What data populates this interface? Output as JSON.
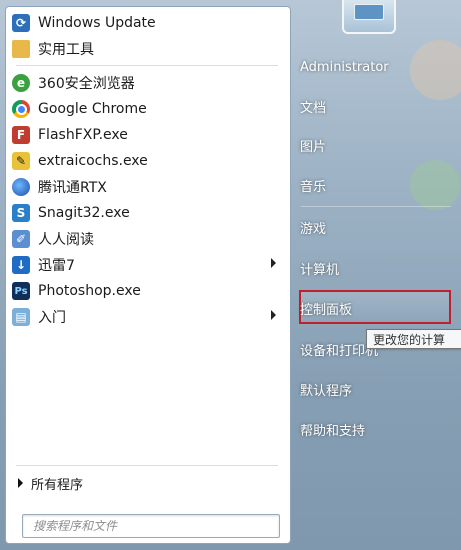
{
  "programs": [
    {
      "label": "Windows Update",
      "icon": "windows-update-icon",
      "arrow": false
    },
    {
      "label": "实用工具",
      "icon": "folder-icon",
      "arrow": false
    },
    {
      "label": "360安全浏览器",
      "icon": "360-browser-icon",
      "arrow": false
    },
    {
      "label": "Google Chrome",
      "icon": "chrome-icon",
      "arrow": false
    },
    {
      "label": "FlashFXP.exe",
      "icon": "flashfxp-icon",
      "arrow": false
    },
    {
      "label": "extraicochs.exe",
      "icon": "extraicochs-icon",
      "arrow": false
    },
    {
      "label": "腾讯通RTX",
      "icon": "rtx-icon",
      "arrow": false
    },
    {
      "label": "Snagit32.exe",
      "icon": "snagit-icon",
      "arrow": false
    },
    {
      "label": "人人阅读",
      "icon": "renren-reader-icon",
      "arrow": false
    },
    {
      "label": "迅雷7",
      "icon": "xunlei-icon",
      "arrow": true
    },
    {
      "label": "Photoshop.exe",
      "icon": "photoshop-icon",
      "arrow": false
    },
    {
      "label": "入门",
      "icon": "getting-started-icon",
      "arrow": true
    }
  ],
  "all_programs": "所有程序",
  "search": {
    "placeholder": "搜索程序和文件"
  },
  "right_menu": {
    "user": "Administrator",
    "documents": "文档",
    "pictures": "图片",
    "music": "音乐",
    "games": "游戏",
    "computer": "计算机",
    "control_panel": "控制面板",
    "devices_printers": "设备和打印机",
    "default_programs": "默认程序",
    "help_support": "帮助和支持"
  },
  "tooltip": "更改您的计算",
  "colors": {
    "highlight_border": "#c0202a"
  }
}
